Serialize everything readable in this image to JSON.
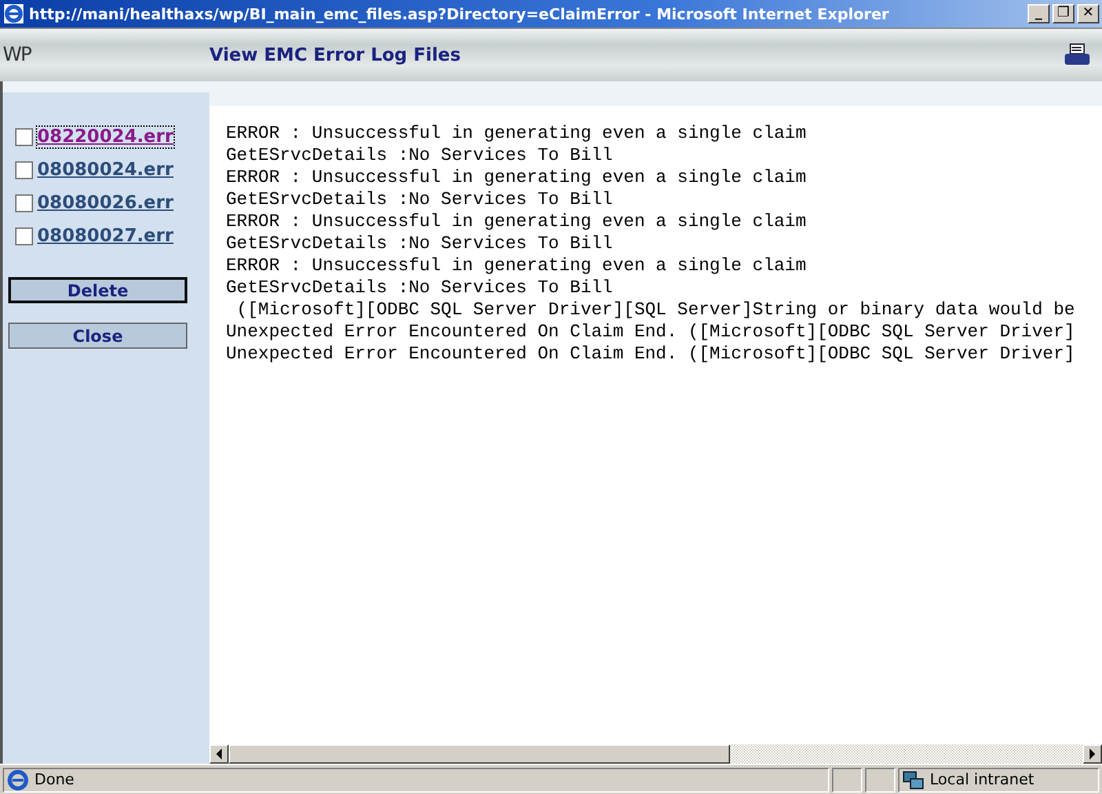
{
  "window": {
    "title": "http://mani/healthaxs/wp/BI_main_emc_files.asp?Directory=eClaimError - Microsoft Internet Explorer",
    "controls": [
      "_",
      "❐",
      "✕"
    ]
  },
  "header": {
    "logo": "WP",
    "title": "View EMC Error Log Files"
  },
  "sidebar": {
    "files": [
      {
        "name": "08220024.err",
        "checked": false,
        "visited": true
      },
      {
        "name": "08080024.err",
        "checked": false,
        "visited": false
      },
      {
        "name": "08080026.err",
        "checked": false,
        "visited": false
      },
      {
        "name": "08080027.err",
        "checked": false,
        "visited": false
      }
    ],
    "buttons": [
      {
        "label": "Delete",
        "focused": true
      },
      {
        "label": "Close",
        "focused": false
      }
    ]
  },
  "log": {
    "lines": [
      "ERROR : Unsuccessful in generating even a single claim",
      "GetESrvcDetails :No Services To Bill",
      "ERROR : Unsuccessful in generating even a single claim",
      "GetESrvcDetails :No Services To Bill",
      "ERROR : Unsuccessful in generating even a single claim",
      "GetESrvcDetails :No Services To Bill",
      "ERROR : Unsuccessful in generating even a single claim",
      "GetESrvcDetails :No Services To Bill",
      " ([Microsoft][ODBC SQL Server Driver][SQL Server]String or binary data would be",
      "Unexpected Error Encountered On Claim End. ([Microsoft][ODBC SQL Server Driver]",
      "Unexpected Error Encountered On Claim End. ([Microsoft][ODBC SQL Server Driver]"
    ]
  },
  "status_bar": {
    "status": "Done",
    "zone": "Local intranet"
  }
}
